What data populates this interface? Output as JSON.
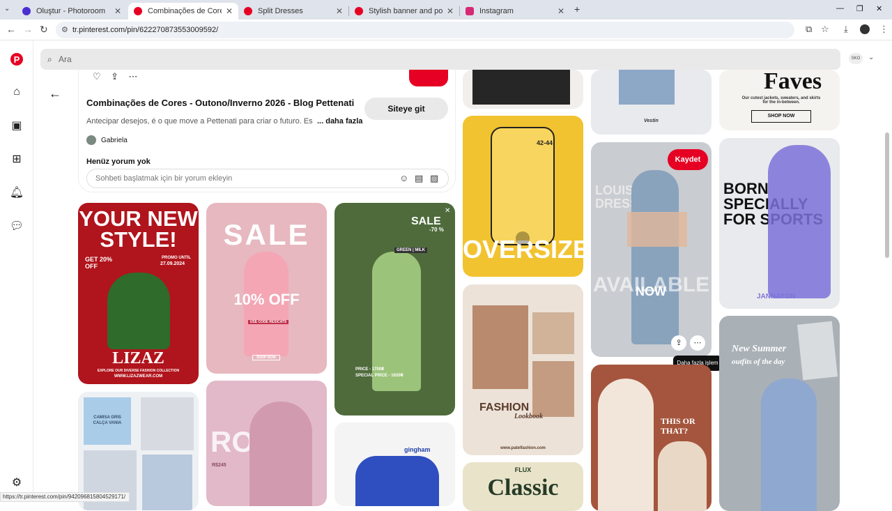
{
  "browser": {
    "tabs": [
      {
        "label": "Oluştur - Photoroom",
        "icon": "photoroom-icon",
        "color": "#4b2fd1"
      },
      {
        "label": "Combinações de Cores - Outon",
        "icon": "pinterest-icon",
        "color": "#e60023"
      },
      {
        "label": "Split Dresses",
        "icon": "pinterest-icon",
        "color": "#e60023"
      },
      {
        "label": "Stylish banner and poster new",
        "icon": "pinterest-icon",
        "color": "#e60023"
      },
      {
        "label": "Instagram",
        "icon": "instagram-icon",
        "color": "#d62976"
      }
    ],
    "new_tab": "+",
    "url": "tr.pinterest.com/pin/622270873553009592/",
    "status_url": "https://tr.pinterest.com/pin/942096815804529171/"
  },
  "search": {
    "placeholder": "Ara"
  },
  "profile": {
    "label": "SKO"
  },
  "pin_detail": {
    "title": "Combinações de Cores - Outono/Inverno 2026 - Blog Pettenati",
    "site_button": "Siteye git",
    "description": "Antecipar desejos, é o que move a Pettenati para criar o futuro. Es",
    "more": "... daha fazla",
    "author": "Gabriela",
    "no_comments": "Henüz yorum yok",
    "comment_placeholder": "Sohbeti başlatmak için bir yorum ekleyin"
  },
  "pins": {
    "save_label": "Kaydet",
    "tooltip": "Daha fazla işlem",
    "p1": {
      "l1": "YOUR NEW",
      "l2": "STYLE!",
      "l3": "GET 20%",
      "l4": "OFF",
      "l5": "LIZAZ",
      "l6": "PROMO UNTIL",
      "l7": "27.09.2024",
      "l8": "EXPLORE OUR DIVERSE FASHION COLLECTION",
      "l9": "WWW.LIZAZWEAR.COM"
    },
    "p2": {
      "l1": "SALE",
      "l2": "10% OFF",
      "l3": "USE CODE RESICATS",
      "l4": "SHOP NOW"
    },
    "p3": {
      "l1": "SALE",
      "l2": "-70 %",
      "l3": "GREEN | MILK",
      "l4": "PRICE - 1700₴",
      "l5": "SPECIAL PRICE - 1630₴"
    },
    "p4": {
      "l1": "OVERSIZE",
      "l2": "42-44"
    },
    "p5": {
      "l1": "FASHION",
      "l2": "Lookbook",
      "l3": "www.patelfashion.com"
    },
    "p6": {
      "l1": "Classic",
      "l2": "FLUX"
    },
    "p7": {
      "l1": "Vestin"
    },
    "p8": {
      "l1": "LOUISIANA",
      "l2": "DRESS",
      "l3": "AVAILABLE",
      "l4": "NOW"
    },
    "p9": {
      "l1": "THIS OR",
      "l2": "THAT?"
    },
    "p10": {
      "l1": "Faves",
      "l2": "Our cutest jackets, sweaters, and skirts for the in-between.",
      "l3": "SHOP NOW"
    },
    "p11": {
      "l1": "BORN",
      "l2": "SPECIALLY",
      "l3": "FOR SPORTS",
      "l4": "JANNAYON"
    },
    "p12": {
      "l1": "New Summer",
      "l2": "outfits of the day"
    },
    "p13": {
      "l1": "CAMISA GRIS",
      "l2": "CALÇA VANIA"
    },
    "p14": {
      "l1": "ROSA",
      "l2": "R$245"
    },
    "p15": {
      "l1": "gingham"
    }
  }
}
